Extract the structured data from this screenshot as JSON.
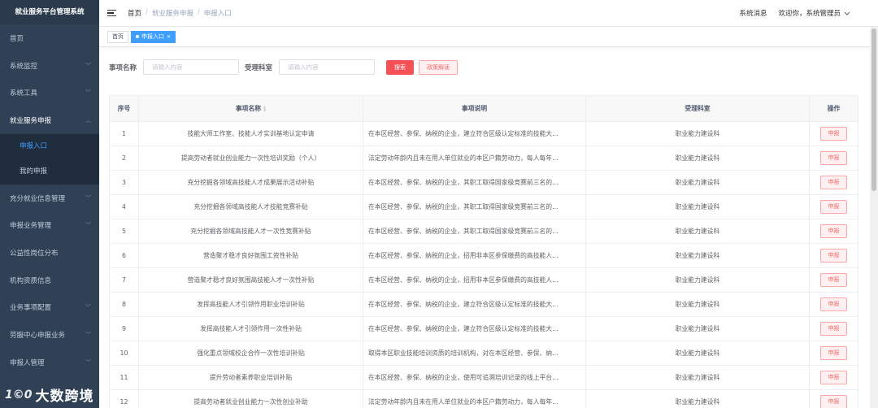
{
  "sidebar": {
    "title": "就业服务平台管理系统",
    "items": [
      {
        "label": "首页",
        "has_chevron": false
      },
      {
        "label": "系统监控",
        "has_chevron": true
      },
      {
        "label": "系统工具",
        "has_chevron": true
      },
      {
        "label": "就业服务申报",
        "has_chevron": true,
        "open": true
      },
      {
        "label": "充分就业信息管理",
        "has_chevron": true
      },
      {
        "label": "申报业务管理",
        "has_chevron": true
      },
      {
        "label": "公益性岗位分布",
        "has_chevron": false
      },
      {
        "label": "机构资质信息",
        "has_chevron": false
      },
      {
        "label": "业务事项配置",
        "has_chevron": true
      },
      {
        "label": "劳服中心申报业务",
        "has_chevron": true
      },
      {
        "label": "申报人管理",
        "has_chevron": true
      }
    ],
    "submenu": [
      {
        "label": "申报入口",
        "active": true
      },
      {
        "label": "我的申报",
        "active": false
      }
    ],
    "watermark": {
      "icon_text": "1©0",
      "text": "大数跨境"
    }
  },
  "header": {
    "breadcrumb": [
      "首页",
      "就业服务申报",
      "申报入口"
    ],
    "messages_label": "系统消息",
    "user_label": "欢迎你，系统管理员"
  },
  "tags": [
    {
      "label": "首页",
      "active": false
    },
    {
      "label": "申报入口",
      "active": true
    }
  ],
  "search": {
    "name_label": "事项名称",
    "name_placeholder": "请输入内容",
    "dept_label": "受理科室",
    "dept_placeholder": "请输入内容",
    "search_button": "搜索",
    "policy_button": "政策解读"
  },
  "table": {
    "headers": [
      "序号",
      "事项名称",
      "事项说明",
      "受理科室",
      "操作"
    ],
    "action_label": "申报",
    "rows": [
      {
        "no": "1",
        "name": "技能大师工作室、技能人才实训基地认定申请",
        "desc": "在本区经营、参保、纳税的企业，建立符合区级认定标准的技能大...",
        "dept": "职业能力建设科"
      },
      {
        "no": "2",
        "name": "提高劳动者就业创业能力一次性培训奖励（个人）",
        "desc": "法定劳动年龄内且未在用人单位就业的本区户籍劳动力，每人每年...",
        "dept": "职业能力建设科"
      },
      {
        "no": "3",
        "name": "充分挖掘各领域高技能人才成果展示活动补贴",
        "desc": "在本区经营、参保、纳税的企业，其职工取得国家级竞赛前三名的...",
        "dept": "职业能力建设科"
      },
      {
        "no": "4",
        "name": "充分挖掘各领域高技能人才技能竞赛补贴",
        "desc": "在本区经营、参保、纳税的企业，其职工取得国家级竞赛前三名的...",
        "dept": "职业能力建设科"
      },
      {
        "no": "5",
        "name": "充分挖掘各领域高技能人才一次性竞赛补贴",
        "desc": "在本区经营、参保、纳税的企业，其职工取得国家级竞赛前三名的...",
        "dept": "职业能力建设科"
      },
      {
        "no": "6",
        "name": "营造聚才稳才良好氛围工资性补贴",
        "desc": "在本区经营、参保、纳税的企业，招用非本区参保缴费的高技能人...",
        "dept": "职业能力建设科"
      },
      {
        "no": "7",
        "name": "营造聚才稳才良好氛围高技能人才一次性补贴",
        "desc": "在本区经营、参保、纳税的企业，招用非本区参保缴费的高技能人...",
        "dept": "职业能力建设科"
      },
      {
        "no": "8",
        "name": "发挥高技能人才引领作用职业培训补贴",
        "desc": "在本区经营、参保、纳税的企业，建立符合区级认定标准的技能大...",
        "dept": "职业能力建设科"
      },
      {
        "no": "9",
        "name": "发挥高技能人才引领作用一次性补贴",
        "desc": "在本区经营、参保、纳税的企业，建立符合区级认定标准的技能大...",
        "dept": "职业能力建设科"
      },
      {
        "no": "10",
        "name": "强化重点领域校企合作一次性培训补贴",
        "desc": "取得本区职业技能培训资质的培训机构，对在本区经营、参保、纳...",
        "dept": "职业能力建设科"
      },
      {
        "no": "11",
        "name": "提升劳动者素养职业培训补贴",
        "desc": "在本区经营、参保、纳税的企业，使用可追溯培训记录的线上平台...",
        "dept": "职业能力建设科"
      },
      {
        "no": "12",
        "name": "提高劳动者就业创业能力一次性创业补助",
        "desc": "法定劳动年龄内且未在用人单位就业的本区户籍劳动力，每人每年...",
        "dept": "职业能力建设科"
      }
    ]
  }
}
